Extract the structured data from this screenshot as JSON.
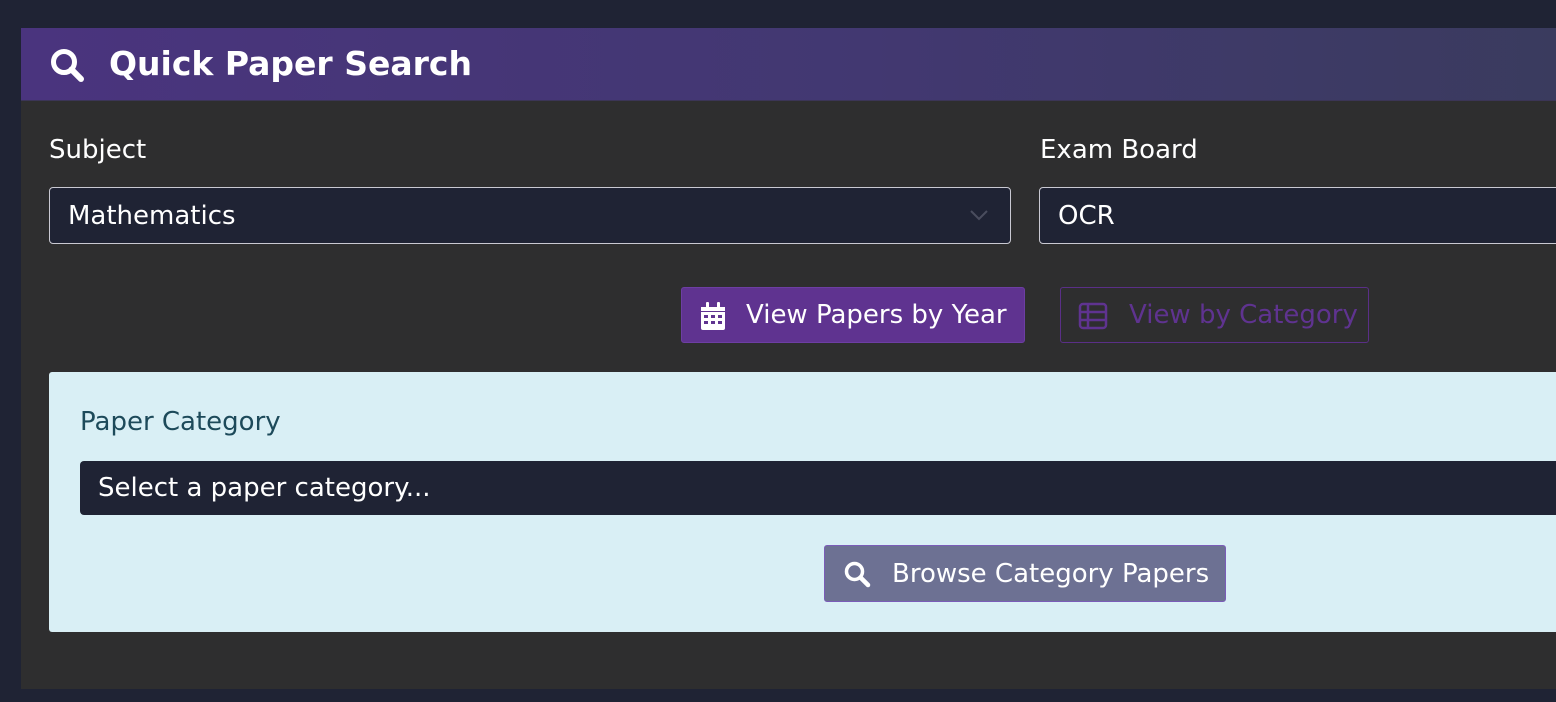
{
  "header": {
    "title": "Quick Paper Search",
    "icon": "search-icon"
  },
  "filters": {
    "subject": {
      "label": "Subject",
      "value": "Mathematics",
      "icon": "chevron-down-icon"
    },
    "exam_board": {
      "label": "Exam Board",
      "value": "OCR"
    }
  },
  "view_toggle": {
    "by_year_label": "View Papers by Year",
    "by_year_icon": "calendar-icon",
    "by_category_label": "View by Category",
    "by_category_icon": "table-list-icon"
  },
  "category_panel": {
    "label": "Paper Category",
    "placeholder": "Select a paper category...",
    "browse_label": "Browse Category Papers",
    "browse_icon": "search-icon"
  },
  "colors": {
    "page_background": "#1f2334",
    "card_background": "#2e2e2f",
    "header_gradient_start": "#4a347e",
    "accent_purple": "#5f3390",
    "panel_background": "#d9eff5",
    "panel_label": "#1d4a5a",
    "browse_button": "#6d7193",
    "category_button_text": "#5f3390"
  }
}
